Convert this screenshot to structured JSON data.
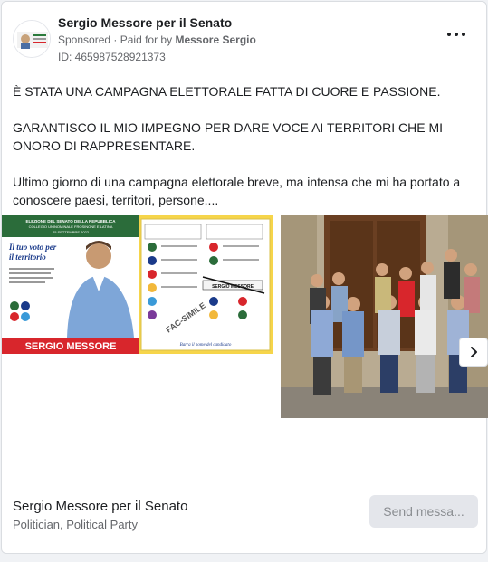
{
  "ad": {
    "page_name": "Sergio Messore per il Senato",
    "sponsored_label": "Sponsored",
    "paid_for_prefix": "Paid for by",
    "paid_for_name": "Messore Sergio",
    "id_label": "ID: 465987528921373",
    "more_icon": "more-horizontal-icon"
  },
  "post": {
    "paragraph_1": "È STATA UNA CAMPAGNA ELETTORALE FATTA DI CUORE E PASSIONE.",
    "paragraph_2": "GARANTISCO IL MIO IMPEGNO PER DARE VOCE AI TERRITORI CHE MI ONORO DI RAPPRESENTARE.",
    "paragraph_3": "Ultimo giorno di una campagna elettorale breve, ma intensa che mi ha portato a conoscere paesi, territori, persone...."
  },
  "carousel": {
    "slide_1": {
      "header_line_1": "ELEZIONE DEL SENATO DELLA REPUBBLICA",
      "header_line_2": "COLLEGIO UNINOMINALE FROSINONE E LATINA",
      "header_line_3": "25 SETTEMBRE 2022",
      "slogan_line_1": "Il tuo voto per",
      "slogan_line_2": "il territorio",
      "candidate_name": "SERGIO MESSORE",
      "ballot_instruction": "Barra il nome del candidato",
      "facsimile": "FAC-SIMILE",
      "ballot_name": "SERGIO MESSORE"
    },
    "next_icon": "chevron-right-icon"
  },
  "footer": {
    "page_name": "Sergio Messore per il Senato",
    "category": "Politician, Political Party",
    "send_button": "Send messa..."
  },
  "colors": {
    "accent_red": "#d8262c",
    "ballot_yellow": "#f6d54a",
    "button_bg": "#e4e6eb"
  }
}
